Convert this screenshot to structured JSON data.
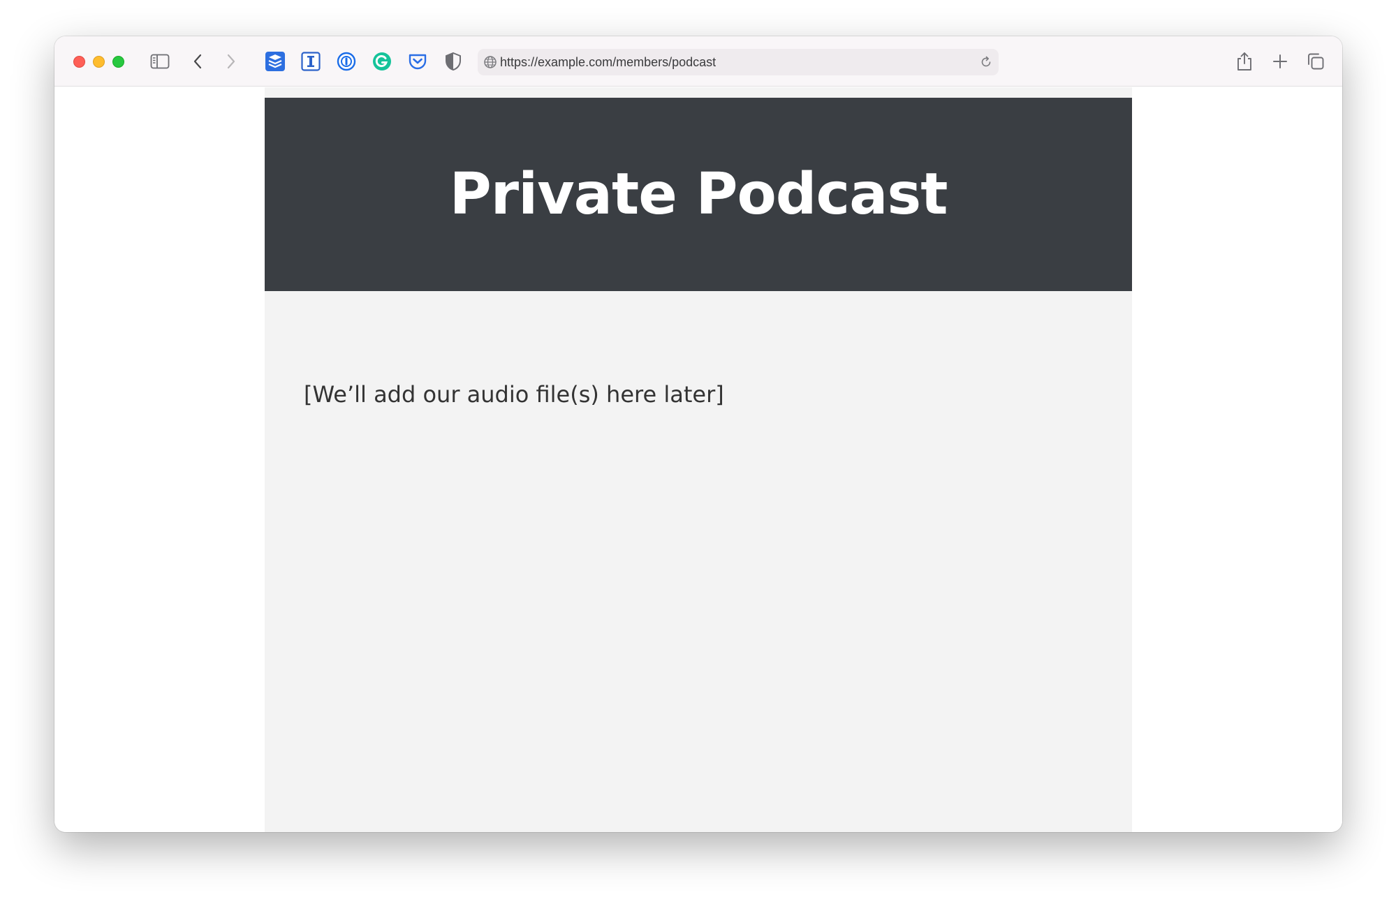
{
  "browser": {
    "url": "https://example.com/members/podcast",
    "toolbar_icons": [
      "sidebar-icon",
      "back-icon",
      "forward-icon",
      "share-icon",
      "new-tab-icon",
      "tab-overview-icon"
    ],
    "extensions": [
      "buffer-extension-icon",
      "instapaper-extension-icon",
      "1password-extension-icon",
      "grammarly-extension-icon",
      "pocket-extension-icon",
      "privacy-shield-extension-icon"
    ],
    "colors": {
      "toolbar_bg": "#f9f6f8",
      "urlbar_bg": "#efebee"
    }
  },
  "page": {
    "title": "Private Podcast",
    "placeholder": "[We’ll add our audio file(s) here later]",
    "colors": {
      "hero_bg": "#3a3e43",
      "body_bg": "#f3f3f3",
      "title_color": "#ffffff"
    }
  }
}
